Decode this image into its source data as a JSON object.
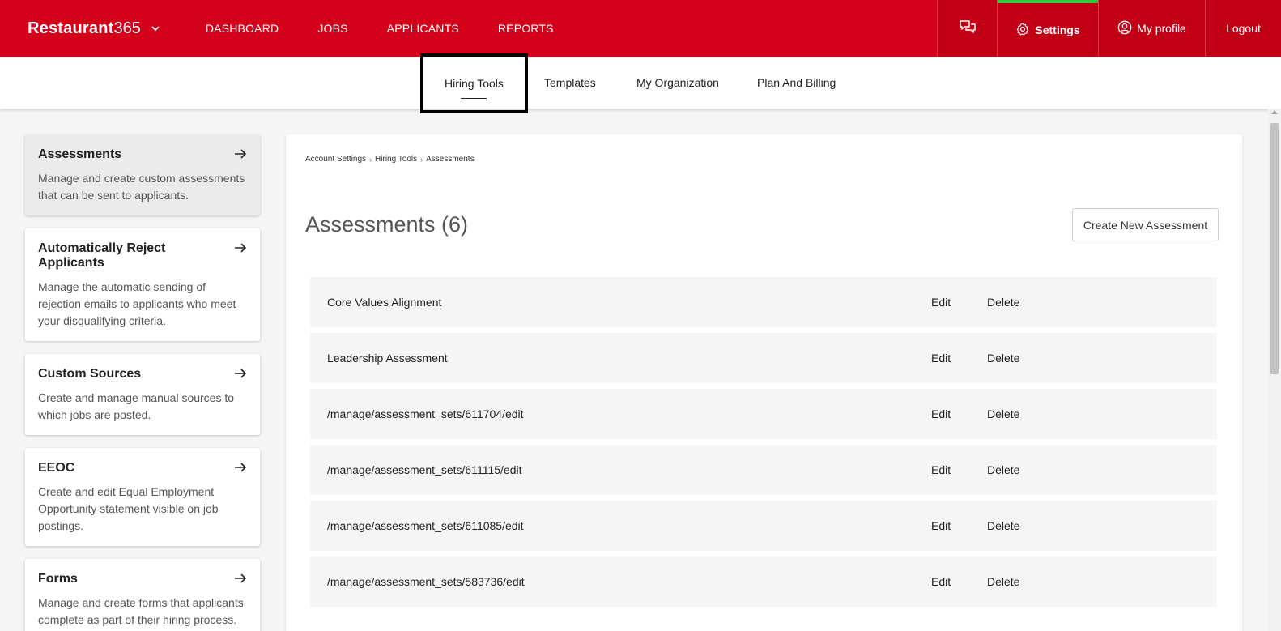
{
  "header": {
    "brand_bold": "Restaurant",
    "brand_light": "365",
    "nav": [
      "DASHBOARD",
      "JOBS",
      "APPLICANTS",
      "REPORTS"
    ],
    "settings_label": "Settings",
    "profile_label": "My profile",
    "logout_label": "Logout"
  },
  "subnav": {
    "tabs": [
      "Hiring Tools",
      "Templates",
      "My Organization",
      "Plan And Billing"
    ],
    "active": "Hiring Tools"
  },
  "sidebar": {
    "items": [
      {
        "title": "Assessments",
        "desc": "Manage and create custom assessments that can be sent to applicants."
      },
      {
        "title": "Automatically Reject Applicants",
        "desc": "Manage the automatic sending of rejection emails to applicants who meet your disqualifying criteria."
      },
      {
        "title": "Custom Sources",
        "desc": "Create and manage manual sources to which jobs are posted."
      },
      {
        "title": "EEOC",
        "desc": "Create and edit Equal Employment Opportunity statement visible on job postings."
      },
      {
        "title": "Forms",
        "desc": "Manage and create forms that applicants complete as part of their hiring process."
      }
    ]
  },
  "breadcrumb": [
    "Account Settings",
    "Hiring Tools",
    "Assessments"
  ],
  "main": {
    "title": "Assessments (6)",
    "create_button": "Create New Assessment",
    "edit_label": "Edit",
    "delete_label": "Delete",
    "rows": [
      "Core Values Alignment",
      "Leadership Assessment",
      "/manage/assessment_sets/611704/edit",
      "/manage/assessment_sets/611115/edit",
      "/manage/assessment_sets/611085/edit",
      "/manage/assessment_sets/583736/edit"
    ]
  },
  "colors": {
    "brand_red": "#d4001a",
    "active_indicator": "#2ecc40"
  }
}
